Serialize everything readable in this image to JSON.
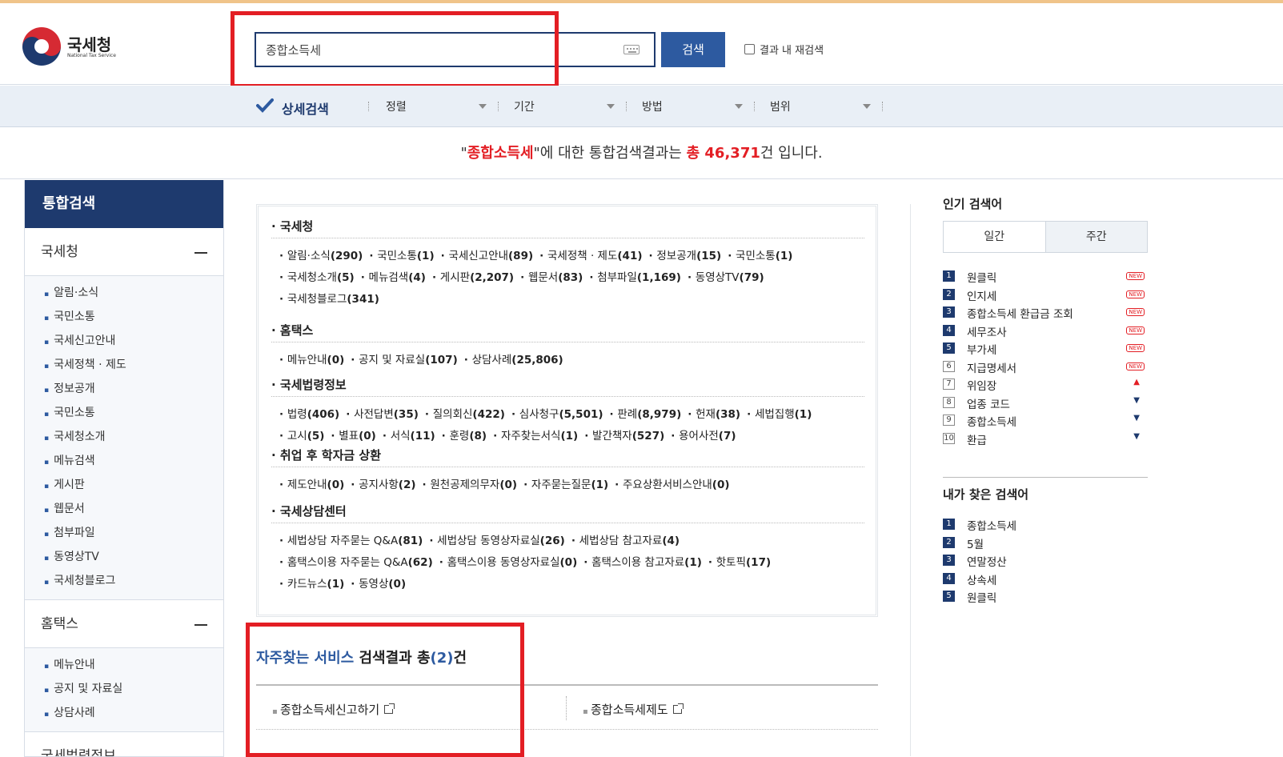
{
  "header": {
    "logo_text": "국세청",
    "logo_sub": "National Tax Service",
    "search_value": "종합소득세",
    "search_button": "검색",
    "re_search_label": "결과 내 재검색"
  },
  "detail_bar": {
    "label": "상세검색",
    "dropdowns": [
      "정렬",
      "기간",
      "방법",
      "범위"
    ]
  },
  "summary": {
    "q_open": "\"",
    "query": "종합소득세",
    "mid": "\"에 대한 통합검색결과는 ",
    "total_label": "총 46,371",
    "tail": "건 입니다."
  },
  "sidebar": {
    "title": "통합검색",
    "groups": [
      {
        "name": "국세청",
        "items": [
          "알림·소식",
          "국민소통",
          "국세신고안내",
          "국세정책 · 제도",
          "정보공개",
          "국민소통",
          "국세청소개",
          "메뉴검색",
          "게시판",
          "웹문서",
          "첨부파일",
          "동영상TV",
          "국세청블로그"
        ]
      },
      {
        "name": "홈택스",
        "items": [
          "메뉴안내",
          "공지 및 자료실",
          "상담사례"
        ]
      },
      {
        "name": "국세법령정보",
        "items": []
      }
    ]
  },
  "results": {
    "sections": [
      {
        "title": "국세청",
        "lines": [
          [
            [
              "알림·소식",
              "(290)"
            ],
            [
              "국민소통",
              "(1)"
            ],
            [
              "국세신고안내",
              "(89)"
            ],
            [
              "국세정책 · 제도",
              "(41)"
            ],
            [
              "정보공개",
              "(15)"
            ],
            [
              "국민소통",
              "(1)"
            ]
          ],
          [
            [
              "국세청소개",
              "(5)"
            ],
            [
              "메뉴검색",
              "(4)"
            ],
            [
              "게시판",
              "(2,207)"
            ],
            [
              "웹문서",
              "(83)"
            ],
            [
              "첨부파일",
              "(1,169)"
            ],
            [
              "동영상TV",
              "(79)"
            ]
          ],
          [
            [
              "국세청블로그",
              "(341)"
            ]
          ]
        ]
      },
      {
        "title": "홈택스",
        "lines": [
          [
            [
              "메뉴안내",
              "(0)"
            ],
            [
              "공지 및 자료실",
              "(107)"
            ],
            [
              "상담사례",
              "(25,806)"
            ]
          ]
        ]
      },
      {
        "title": "국세법령정보",
        "lines": [
          [
            [
              "법령",
              "(406)"
            ],
            [
              "사전답변",
              "(35)"
            ],
            [
              "질의회신",
              "(422)"
            ],
            [
              "심사청구",
              "(5,501)"
            ],
            [
              "판례",
              "(8,979)"
            ],
            [
              "헌재",
              "(38)"
            ],
            [
              "세법집행",
              "(1)"
            ]
          ],
          [
            [
              "고시",
              "(5)"
            ],
            [
              "별표",
              "(0)"
            ],
            [
              "서식",
              "(11)"
            ],
            [
              "훈령",
              "(8)"
            ],
            [
              "자주찾는서식",
              "(1)"
            ],
            [
              "발간책자",
              "(527)"
            ],
            [
              "용어사전",
              "(7)"
            ]
          ]
        ]
      },
      {
        "title": "취업 후 학자금 상환",
        "lines": [
          [
            [
              "제도안내",
              "(0)"
            ],
            [
              "공지사항",
              "(2)"
            ],
            [
              "원천공제의무자",
              "(0)"
            ],
            [
              "자주묻는질문",
              "(1)"
            ],
            [
              "주요상환서비스안내",
              "(0)"
            ]
          ]
        ]
      },
      {
        "title": "국세상담센터",
        "lines": [
          [
            [
              "세법상담 자주묻는 Q&A",
              "(81)"
            ],
            [
              "세법상담 동영상자료실",
              "(26)"
            ],
            [
              "세법상담 참고자료",
              "(4)"
            ]
          ],
          [
            [
              "홈택스이용 자주묻는 Q&A",
              "(62)"
            ],
            [
              "홈택스이용 동영상자료실",
              "(0)"
            ],
            [
              "홈택스이용 참고자료",
              "(1)"
            ],
            [
              "핫토픽",
              "(17)"
            ]
          ],
          [
            [
              "카드뉴스",
              "(1)"
            ],
            [
              "동영상",
              "(0)"
            ]
          ]
        ]
      }
    ]
  },
  "services": {
    "title_blue": "자주찾는 서비스",
    "title_rest": " 검색결과 총",
    "count": "(2)",
    "title_end": "건",
    "items": [
      "종합소득세신고하기",
      "종합소득세제도"
    ]
  },
  "popular": {
    "title": "인기 검색어",
    "tabs": [
      "일간",
      "주간"
    ],
    "items": [
      {
        "rank": "1",
        "kw": "원클릭",
        "badge": "NEW"
      },
      {
        "rank": "2",
        "kw": "인지세",
        "badge": "NEW"
      },
      {
        "rank": "3",
        "kw": "종합소득세 환급금 조회",
        "badge": "NEW"
      },
      {
        "rank": "4",
        "kw": "세무조사",
        "badge": "NEW"
      },
      {
        "rank": "5",
        "kw": "부가세",
        "badge": "NEW"
      },
      {
        "rank": "6",
        "kw": "지급명세서",
        "badge": "NEW"
      },
      {
        "rank": "7",
        "kw": "위임장",
        "badge": "up"
      },
      {
        "rank": "8",
        "kw": "업종 코드",
        "badge": "down"
      },
      {
        "rank": "9",
        "kw": "종합소득세",
        "badge": "down"
      },
      {
        "rank": "10",
        "kw": "환급",
        "badge": "down"
      }
    ]
  },
  "my_searches": {
    "title": "내가 찾은 검색어",
    "items": [
      {
        "rank": "1",
        "kw": "종합소득세"
      },
      {
        "rank": "2",
        "kw": "5월"
      },
      {
        "rank": "3",
        "kw": "연말정산"
      },
      {
        "rank": "4",
        "kw": "상속세"
      },
      {
        "rank": "5",
        "kw": "원클릭"
      }
    ]
  },
  "colors": {
    "navy": "#1e3a6e",
    "blue": "#2d5aa0",
    "red": "#e31e24"
  }
}
